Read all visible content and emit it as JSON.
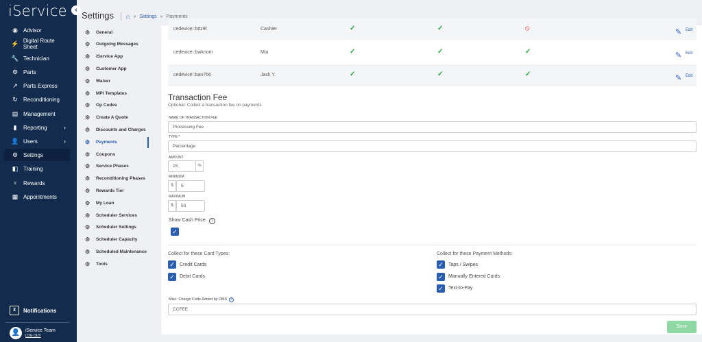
{
  "app": {
    "logo": "iService",
    "collapse": "‹"
  },
  "sidebar": {
    "items": [
      {
        "label": "Advisor",
        "icon": "eye-icon",
        "glyph": "◉"
      },
      {
        "label": "Digital Route Sheet",
        "icon": "bolt-icon",
        "glyph": "⚡"
      },
      {
        "label": "Technician",
        "icon": "wrench-icon",
        "glyph": "🔧"
      },
      {
        "label": "Parts",
        "icon": "gear-icon",
        "glyph": "⚙"
      },
      {
        "label": "Parts Express",
        "icon": "trend-icon",
        "glyph": "↗"
      },
      {
        "label": "Reconditioning",
        "icon": "refresh-icon",
        "glyph": "↻"
      },
      {
        "label": "Management",
        "icon": "document-icon",
        "glyph": "▤"
      },
      {
        "label": "Reporting",
        "icon": "chart-icon",
        "glyph": "▮"
      },
      {
        "label": "Users",
        "icon": "user-icon",
        "glyph": "👤"
      },
      {
        "label": "Settings",
        "icon": "settings-icon",
        "glyph": "⚙"
      },
      {
        "label": "Training",
        "icon": "training-icon",
        "glyph": "◧"
      },
      {
        "label": "Rewards",
        "icon": "trophy-icon",
        "glyph": "♆"
      },
      {
        "label": "Appointments",
        "icon": "calendar-icon",
        "glyph": "▦"
      }
    ],
    "notifications": {
      "label": "Notifications",
      "count": "3"
    },
    "user": {
      "name": "iService Team",
      "logout": "LOG OUT"
    }
  },
  "header": {
    "title": "Settings",
    "breadcrumb": [
      "Settings",
      "Payments"
    ],
    "sep": "»"
  },
  "submenu": [
    "General",
    "Outgoing Messages",
    "iService App",
    "Customer App",
    "Waiver",
    "MPI Templates",
    "Op Codes",
    "Create A Quote",
    "Discounts and Charges",
    "Payments",
    "Coupons",
    "Service Phases",
    "Reconditioning Phases",
    "Rewards Tier",
    "My Loan",
    "Scheduler Services",
    "Scheduler Settings",
    "Scheduler Capacity",
    "Scheduled Maintenance",
    "Tools"
  ],
  "devices": [
    {
      "id": "cedevice::bttz9f",
      "name": "Cashier",
      "c1": "✓",
      "c2": "✓",
      "c3": "⦸",
      "c3_denied": true
    },
    {
      "id": "cedevice::bwknom",
      "name": "Mia",
      "c1": "✓",
      "c2": "✓",
      "c3": "✓",
      "c3_denied": false
    },
    {
      "id": "cedevice::ban766",
      "name": "Jack Y.",
      "c1": "✓",
      "c2": "✓",
      "c3": "✓",
      "c3_denied": false
    }
  ],
  "edit_label": "Edit",
  "fee": {
    "title": "Transaction Fee",
    "subtitle": "Optional: Collect a transaction fee on payments",
    "name_label": "NAME OF TRANSACTION FEE",
    "name_value": "Processing Fee",
    "type_label": "TYPE *",
    "type_value": "Percentage",
    "amount_label": "AMOUNT",
    "amount_value": "15",
    "amount_suffix": "%",
    "min_label": "MINIMUM",
    "min_value": "5",
    "currency": "$",
    "max_label": "MAXIMUM",
    "max_value": "50",
    "cash_label": "Show Cash Price",
    "info": "i",
    "card_heading": "Collect for these Card Types:",
    "cards": [
      "Credit Cards",
      "Debit Cards"
    ],
    "method_heading": "Collect for these Payment Methods:",
    "methods": [
      "Taps / Swipes",
      "Manually Entered Cards",
      "Text-to-Pay"
    ],
    "misc_label": "Misc. Charge Code Added by DMS",
    "misc_value": "CCFEE",
    "save": "Save"
  }
}
